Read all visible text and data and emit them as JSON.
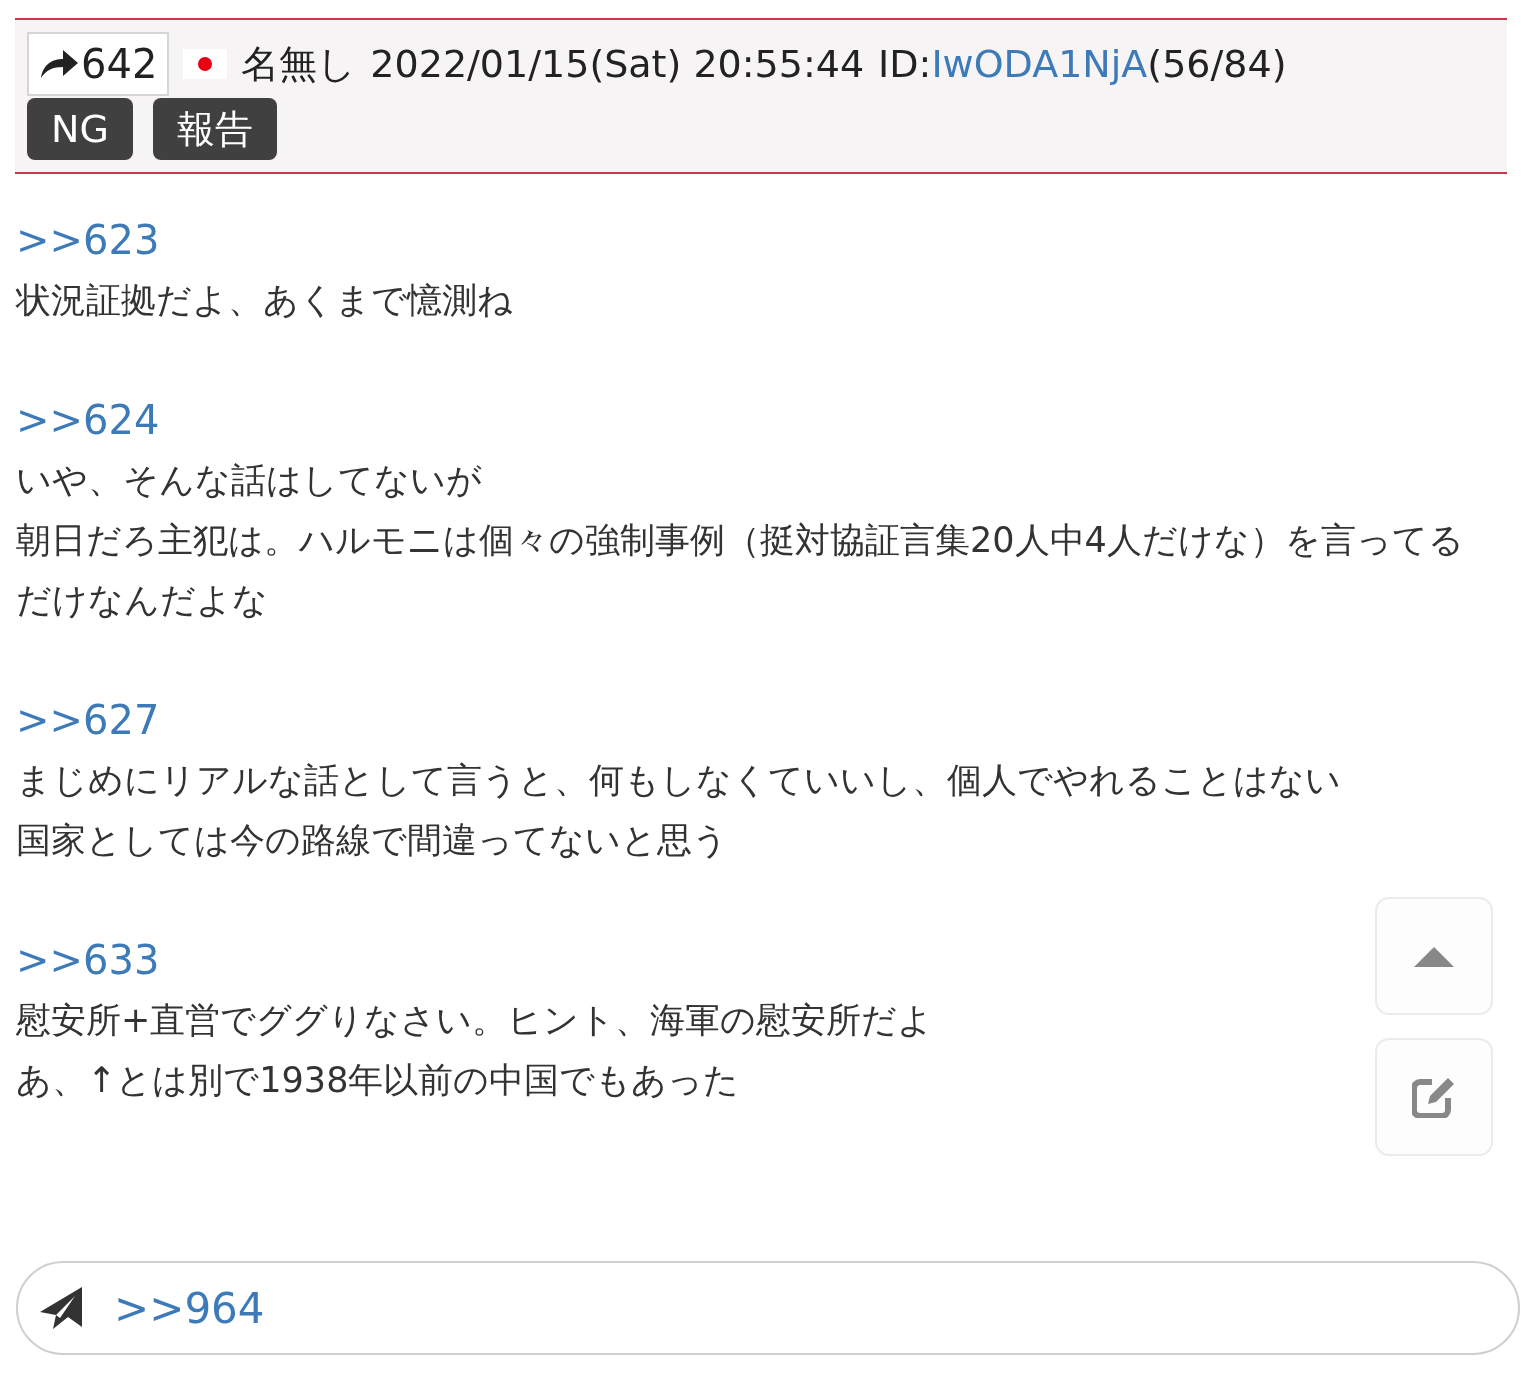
{
  "post": {
    "number": "642",
    "name": "名無し",
    "date": "2022/01/15(Sat) 20:55:44",
    "id_label": "ID:",
    "id": "IwODA1NjA",
    "count": "(56/84)",
    "buttons": [
      "NG",
      "報告"
    ]
  },
  "replies": [
    {
      "ref": ">>623",
      "lines": [
        "状況証拠だよ、あくまで憶測ね"
      ]
    },
    {
      "ref": ">>624",
      "lines": [
        "いや、そんな話はしてないが",
        "朝日だろ主犯は。ハルモニは個々の強制事例（挺対協証言集20人中4人だけな）を言ってるだけなんだよな"
      ]
    },
    {
      "ref": ">>627",
      "lines": [
        "まじめにリアルな話として言うと、何もしなくていいし、個人でやれることはない",
        "国家としては今の路線で間違ってないと思う"
      ]
    },
    {
      "ref": ">>633",
      "lines": [
        "慰安所+直営でググりなさい。ヒント、海軍の慰安所だよ",
        "あ、↑とは別で1938年以前の中国でもあった"
      ]
    }
  ],
  "reply_field": {
    "value": ">>964"
  }
}
